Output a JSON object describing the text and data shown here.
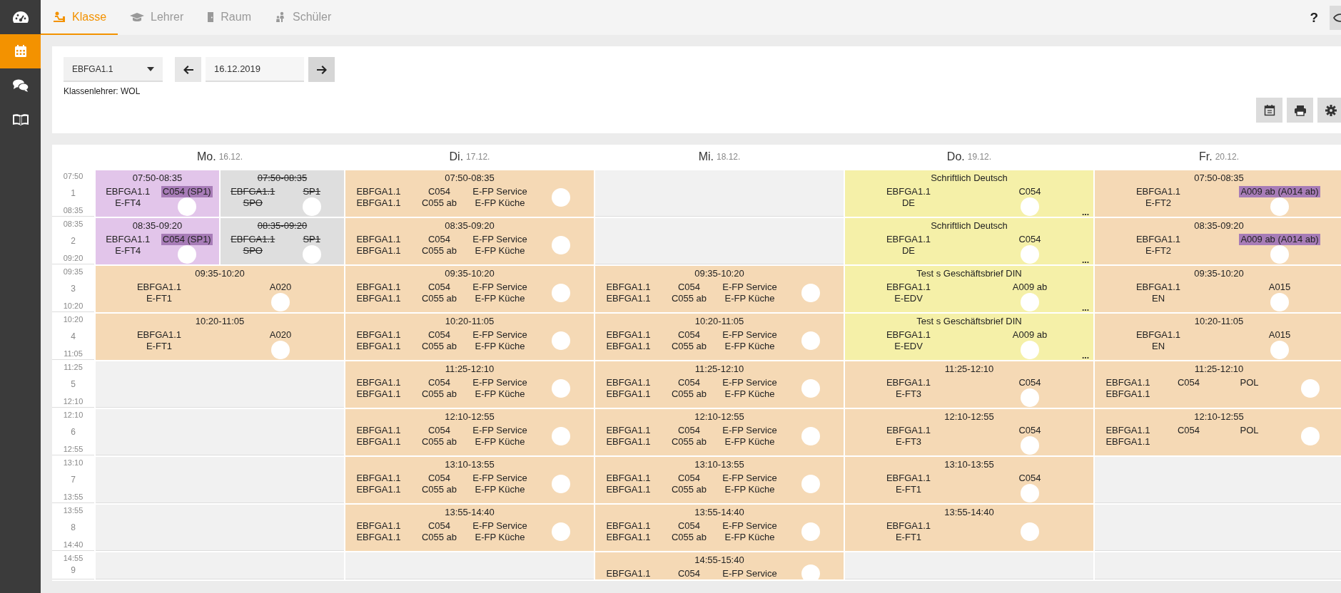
{
  "sidebar": {
    "items": [
      {
        "selected": false
      },
      {
        "selected": true
      },
      {
        "selected": false
      },
      {
        "selected": false
      }
    ]
  },
  "tabs": [
    {
      "label": "Klasse",
      "selected": true
    },
    {
      "label": "Lehrer",
      "selected": false
    },
    {
      "label": "Raum",
      "selected": false
    },
    {
      "label": "Schüler",
      "selected": false
    }
  ],
  "help": "?",
  "filter": {
    "class": "EBFGA1.1",
    "date": "16.12.2019",
    "class_teacher": "Klassenlehrer: WOL"
  },
  "timetable": {
    "days": [
      {
        "name": "Mo.",
        "date": "16.12."
      },
      {
        "name": "Di.",
        "date": "17.12."
      },
      {
        "name": "Mi.",
        "date": "18.12."
      },
      {
        "name": "Do.",
        "date": "19.12."
      },
      {
        "name": "Fr.",
        "date": "20.12."
      }
    ],
    "periods": [
      {
        "number": "1",
        "start": "07:50",
        "end": "08:35",
        "days": [
          {
            "kind": "lessons",
            "lessons": [
              {
                "kind": "changed",
                "header": "07:50-08:35",
                "columns": [
                  [
                    "EBFGA1.1",
                    "E-FT4"
                  ],
                  [
                    {
                      "text": "C054 (SP1)",
                      "highlight": true
                    },
                    {
                      "kind": "redaction"
                    }
                  ]
                ]
              },
              {
                "kind": "cancelled",
                "header": "07:50-08:35",
                "columns": [
                  [
                    "EBFGA1.1",
                    "SPO"
                  ],
                  [
                    "SP1",
                    {
                      "kind": "redaction"
                    }
                  ]
                ]
              }
            ]
          },
          {
            "kind": "lessons",
            "lessons": [
              {
                "kind": "regular",
                "header": "07:50-08:35",
                "columns": [
                  [
                    "EBFGA1.1",
                    "EBFGA1.1"
                  ],
                  [
                    "C054",
                    "C055 ab"
                  ],
                  [
                    "E-FP Service",
                    "E-FP Küche"
                  ],
                  [
                    {
                      "kind": "redaction"
                    }
                  ]
                ]
              }
            ]
          },
          {
            "kind": "free"
          },
          {
            "kind": "lessons",
            "lessons": [
              {
                "kind": "exam",
                "header": "Schriftlich Deutsch",
                "columns": [
                  [
                    "EBFGA1.1",
                    "DE"
                  ],
                  [
                    "C054",
                    {
                      "kind": "redaction"
                    }
                  ]
                ],
                "more": "..."
              }
            ]
          },
          {
            "kind": "lessons",
            "lessons": [
              {
                "kind": "regular",
                "header": "07:50-08:35",
                "columns": [
                  [
                    "EBFGA1.1",
                    "E-FT2"
                  ],
                  [
                    {
                      "text": "A009 ab (A014 ab)",
                      "highlight": true
                    },
                    {
                      "kind": "redaction"
                    }
                  ]
                ]
              }
            ]
          }
        ]
      },
      {
        "number": "2",
        "start": "08:35",
        "end": "09:20",
        "days": [
          {
            "kind": "lessons",
            "lessons": [
              {
                "kind": "changed",
                "header": "08:35-09:20",
                "columns": [
                  [
                    "EBFGA1.1",
                    "E-FT4"
                  ],
                  [
                    {
                      "text": "C054 (SP1)",
                      "highlight": true
                    },
                    {
                      "kind": "redaction"
                    }
                  ]
                ]
              },
              {
                "kind": "cancelled",
                "header": "08:35-09:20",
                "columns": [
                  [
                    "EBFGA1.1",
                    "SPO"
                  ],
                  [
                    "SP1",
                    {
                      "kind": "redaction"
                    }
                  ]
                ]
              }
            ]
          },
          {
            "kind": "lessons",
            "lessons": [
              {
                "kind": "regular",
                "header": "08:35-09:20",
                "columns": [
                  [
                    "EBFGA1.1",
                    "EBFGA1.1"
                  ],
                  [
                    "C054",
                    "C055 ab"
                  ],
                  [
                    "E-FP Service",
                    "E-FP Küche"
                  ],
                  [
                    {
                      "kind": "redaction"
                    }
                  ]
                ]
              }
            ]
          },
          {
            "kind": "free"
          },
          {
            "kind": "lessons",
            "lessons": [
              {
                "kind": "exam",
                "header": "Schriftlich Deutsch",
                "columns": [
                  [
                    "EBFGA1.1",
                    "DE"
                  ],
                  [
                    "C054",
                    {
                      "kind": "redaction"
                    }
                  ]
                ],
                "more": "..."
              }
            ]
          },
          {
            "kind": "lessons",
            "lessons": [
              {
                "kind": "regular",
                "header": "08:35-09:20",
                "columns": [
                  [
                    "EBFGA1.1",
                    "E-FT2"
                  ],
                  [
                    {
                      "text": "A009 ab (A014 ab)",
                      "highlight": true
                    },
                    {
                      "kind": "redaction"
                    }
                  ]
                ]
              }
            ]
          }
        ]
      },
      {
        "number": "3",
        "start": "09:35",
        "end": "10:20",
        "days": [
          {
            "kind": "lessons",
            "lessons": [
              {
                "kind": "regular",
                "header": "09:35-10:20",
                "columns": [
                  [
                    "EBFGA1.1",
                    "E-FT1"
                  ],
                  [
                    "A020",
                    {
                      "kind": "redaction"
                    }
                  ]
                ]
              }
            ]
          },
          {
            "kind": "lessons",
            "lessons": [
              {
                "kind": "regular",
                "header": "09:35-10:20",
                "columns": [
                  [
                    "EBFGA1.1",
                    "EBFGA1.1"
                  ],
                  [
                    "C054",
                    "C055 ab"
                  ],
                  [
                    "E-FP Service",
                    "E-FP Küche"
                  ],
                  [
                    {
                      "kind": "redaction"
                    }
                  ]
                ]
              }
            ]
          },
          {
            "kind": "lessons",
            "lessons": [
              {
                "kind": "regular",
                "header": "09:35-10:20",
                "columns": [
                  [
                    "EBFGA1.1",
                    "EBFGA1.1"
                  ],
                  [
                    "C054",
                    "C055 ab"
                  ],
                  [
                    "E-FP Service",
                    "E-FP Küche"
                  ],
                  [
                    {
                      "kind": "redaction"
                    }
                  ]
                ]
              }
            ]
          },
          {
            "kind": "lessons",
            "lessons": [
              {
                "kind": "exam",
                "header": "Test s Geschäftsbrief DIN",
                "columns": [
                  [
                    "EBFGA1.1",
                    "E-EDV"
                  ],
                  [
                    "A009 ab",
                    {
                      "kind": "redaction"
                    }
                  ]
                ],
                "more": "..."
              }
            ]
          },
          {
            "kind": "lessons",
            "lessons": [
              {
                "kind": "regular",
                "header": "09:35-10:20",
                "columns": [
                  [
                    "EBFGA1.1",
                    "EN"
                  ],
                  [
                    "A015",
                    {
                      "kind": "redaction"
                    }
                  ]
                ]
              }
            ]
          }
        ]
      },
      {
        "number": "4",
        "start": "10:20",
        "end": "11:05",
        "days": [
          {
            "kind": "lessons",
            "lessons": [
              {
                "kind": "regular",
                "header": "10:20-11:05",
                "columns": [
                  [
                    "EBFGA1.1",
                    "E-FT1"
                  ],
                  [
                    "A020",
                    {
                      "kind": "redaction"
                    }
                  ]
                ]
              }
            ]
          },
          {
            "kind": "lessons",
            "lessons": [
              {
                "kind": "regular",
                "header": "10:20-11:05",
                "columns": [
                  [
                    "EBFGA1.1",
                    "EBFGA1.1"
                  ],
                  [
                    "C054",
                    "C055 ab"
                  ],
                  [
                    "E-FP Service",
                    "E-FP Küche"
                  ],
                  [
                    {
                      "kind": "redaction"
                    }
                  ]
                ]
              }
            ]
          },
          {
            "kind": "lessons",
            "lessons": [
              {
                "kind": "regular",
                "header": "10:20-11:05",
                "columns": [
                  [
                    "EBFGA1.1",
                    "EBFGA1.1"
                  ],
                  [
                    "C054",
                    "C055 ab"
                  ],
                  [
                    "E-FP Service",
                    "E-FP Küche"
                  ],
                  [
                    {
                      "kind": "redaction"
                    }
                  ]
                ]
              }
            ]
          },
          {
            "kind": "lessons",
            "lessons": [
              {
                "kind": "exam",
                "header": "Test s Geschäftsbrief DIN",
                "columns": [
                  [
                    "EBFGA1.1",
                    "E-EDV"
                  ],
                  [
                    "A009 ab",
                    {
                      "kind": "redaction"
                    }
                  ]
                ],
                "more": "..."
              }
            ]
          },
          {
            "kind": "lessons",
            "lessons": [
              {
                "kind": "regular",
                "header": "10:20-11:05",
                "columns": [
                  [
                    "EBFGA1.1",
                    "EN"
                  ],
                  [
                    "A015",
                    {
                      "kind": "redaction"
                    }
                  ]
                ]
              }
            ]
          }
        ]
      },
      {
        "number": "5",
        "start": "11:25",
        "end": "12:10",
        "days": [
          {
            "kind": "free"
          },
          {
            "kind": "lessons",
            "lessons": [
              {
                "kind": "regular",
                "header": "11:25-12:10",
                "columns": [
                  [
                    "EBFGA1.1",
                    "EBFGA1.1"
                  ],
                  [
                    "C054",
                    "C055 ab"
                  ],
                  [
                    "E-FP Service",
                    "E-FP Küche"
                  ],
                  [
                    {
                      "kind": "redaction"
                    }
                  ]
                ]
              }
            ]
          },
          {
            "kind": "lessons",
            "lessons": [
              {
                "kind": "regular",
                "header": "11:25-12:10",
                "columns": [
                  [
                    "EBFGA1.1",
                    "EBFGA1.1"
                  ],
                  [
                    "C054",
                    "C055 ab"
                  ],
                  [
                    "E-FP Service",
                    "E-FP Küche"
                  ],
                  [
                    {
                      "kind": "redaction"
                    }
                  ]
                ]
              }
            ]
          },
          {
            "kind": "lessons",
            "lessons": [
              {
                "kind": "regular",
                "header": "11:25-12:10",
                "columns": [
                  [
                    "EBFGA1.1",
                    "E-FT3"
                  ],
                  [
                    "C054",
                    {
                      "kind": "redaction"
                    }
                  ]
                ]
              }
            ]
          },
          {
            "kind": "lessons",
            "lessons": [
              {
                "kind": "regular",
                "header": "11:25-12:10",
                "columns": [
                  [
                    "EBFGA1.1",
                    "EBFGA1.1"
                  ],
                  [
                    "C054"
                  ],
                  [
                    "POL"
                  ],
                  [
                    {
                      "kind": "redaction"
                    }
                  ]
                ]
              }
            ]
          }
        ]
      },
      {
        "number": "6",
        "start": "12:10",
        "end": "12:55",
        "days": [
          {
            "kind": "free"
          },
          {
            "kind": "lessons",
            "lessons": [
              {
                "kind": "regular",
                "header": "12:10-12:55",
                "columns": [
                  [
                    "EBFGA1.1",
                    "EBFGA1.1"
                  ],
                  [
                    "C054",
                    "C055 ab"
                  ],
                  [
                    "E-FP Service",
                    "E-FP Küche"
                  ],
                  [
                    {
                      "kind": "redaction"
                    }
                  ]
                ]
              }
            ]
          },
          {
            "kind": "lessons",
            "lessons": [
              {
                "kind": "regular",
                "header": "12:10-12:55",
                "columns": [
                  [
                    "EBFGA1.1",
                    "EBFGA1.1"
                  ],
                  [
                    "C054",
                    "C055 ab"
                  ],
                  [
                    "E-FP Service",
                    "E-FP Küche"
                  ],
                  [
                    {
                      "kind": "redaction"
                    }
                  ]
                ]
              }
            ]
          },
          {
            "kind": "lessons",
            "lessons": [
              {
                "kind": "regular",
                "header": "12:10-12:55",
                "columns": [
                  [
                    "EBFGA1.1",
                    "E-FT3"
                  ],
                  [
                    "C054",
                    {
                      "kind": "redaction"
                    }
                  ]
                ]
              }
            ]
          },
          {
            "kind": "lessons",
            "lessons": [
              {
                "kind": "regular",
                "header": "12:10-12:55",
                "columns": [
                  [
                    "EBFGA1.1",
                    "EBFGA1.1"
                  ],
                  [
                    "C054"
                  ],
                  [
                    "POL"
                  ],
                  [
                    {
                      "kind": "redaction"
                    }
                  ]
                ]
              }
            ]
          }
        ]
      },
      {
        "number": "7",
        "start": "13:10",
        "end": "13:55",
        "days": [
          {
            "kind": "free"
          },
          {
            "kind": "lessons",
            "lessons": [
              {
                "kind": "regular",
                "header": "13:10-13:55",
                "columns": [
                  [
                    "EBFGA1.1",
                    "EBFGA1.1"
                  ],
                  [
                    "C054",
                    "C055 ab"
                  ],
                  [
                    "E-FP Service",
                    "E-FP Küche"
                  ],
                  [
                    {
                      "kind": "redaction"
                    }
                  ]
                ]
              }
            ]
          },
          {
            "kind": "lessons",
            "lessons": [
              {
                "kind": "regular",
                "header": "13:10-13:55",
                "columns": [
                  [
                    "EBFGA1.1",
                    "EBFGA1.1"
                  ],
                  [
                    "C054",
                    "C055 ab"
                  ],
                  [
                    "E-FP Service",
                    "E-FP Küche"
                  ],
                  [
                    {
                      "kind": "redaction"
                    }
                  ]
                ]
              }
            ]
          },
          {
            "kind": "lessons",
            "lessons": [
              {
                "kind": "regular",
                "header": "13:10-13:55",
                "columns": [
                  [
                    "EBFGA1.1",
                    "E-FT1"
                  ],
                  [
                    "C054",
                    {
                      "kind": "redaction"
                    }
                  ]
                ]
              }
            ]
          },
          {
            "kind": "free"
          }
        ]
      },
      {
        "number": "8",
        "start": "13:55",
        "end": "14:40",
        "days": [
          {
            "kind": "free"
          },
          {
            "kind": "lessons",
            "lessons": [
              {
                "kind": "regular",
                "header": "13:55-14:40",
                "columns": [
                  [
                    "EBFGA1.1",
                    "EBFGA1.1"
                  ],
                  [
                    "C054",
                    "C055 ab"
                  ],
                  [
                    "E-FP Service",
                    "E-FP Küche"
                  ],
                  [
                    {
                      "kind": "redaction"
                    }
                  ]
                ]
              }
            ]
          },
          {
            "kind": "lessons",
            "lessons": [
              {
                "kind": "regular",
                "header": "13:55-14:40",
                "columns": [
                  [
                    "EBFGA1.1",
                    "EBFGA1.1"
                  ],
                  [
                    "C054",
                    "C055 ab"
                  ],
                  [
                    "E-FP Service",
                    "E-FP Küche"
                  ],
                  [
                    {
                      "kind": "redaction"
                    }
                  ]
                ]
              }
            ]
          },
          {
            "kind": "lessons",
            "lessons": [
              {
                "kind": "regular",
                "header": "13:55-14:40",
                "columns": [
                  [
                    "EBFGA1.1",
                    "E-FT1"
                  ],
                  [
                    {
                      "kind": "redaction"
                    }
                  ]
                ]
              }
            ]
          },
          {
            "kind": "free"
          }
        ]
      },
      {
        "number": "9",
        "start": "14:55",
        "days": [
          {
            "kind": "free"
          },
          {
            "kind": "free"
          },
          {
            "kind": "lessons",
            "lessons": [
              {
                "kind": "regular",
                "header": "14:55-15:40",
                "columns": [
                  [
                    "EBFGA1.1"
                  ],
                  [
                    "C054"
                  ],
                  [
                    "E-FP Service"
                  ],
                  [
                    {
                      "kind": "redaction"
                    }
                  ]
                ]
              }
            ]
          },
          {
            "kind": "free"
          },
          {
            "kind": "free"
          }
        ]
      }
    ]
  }
}
